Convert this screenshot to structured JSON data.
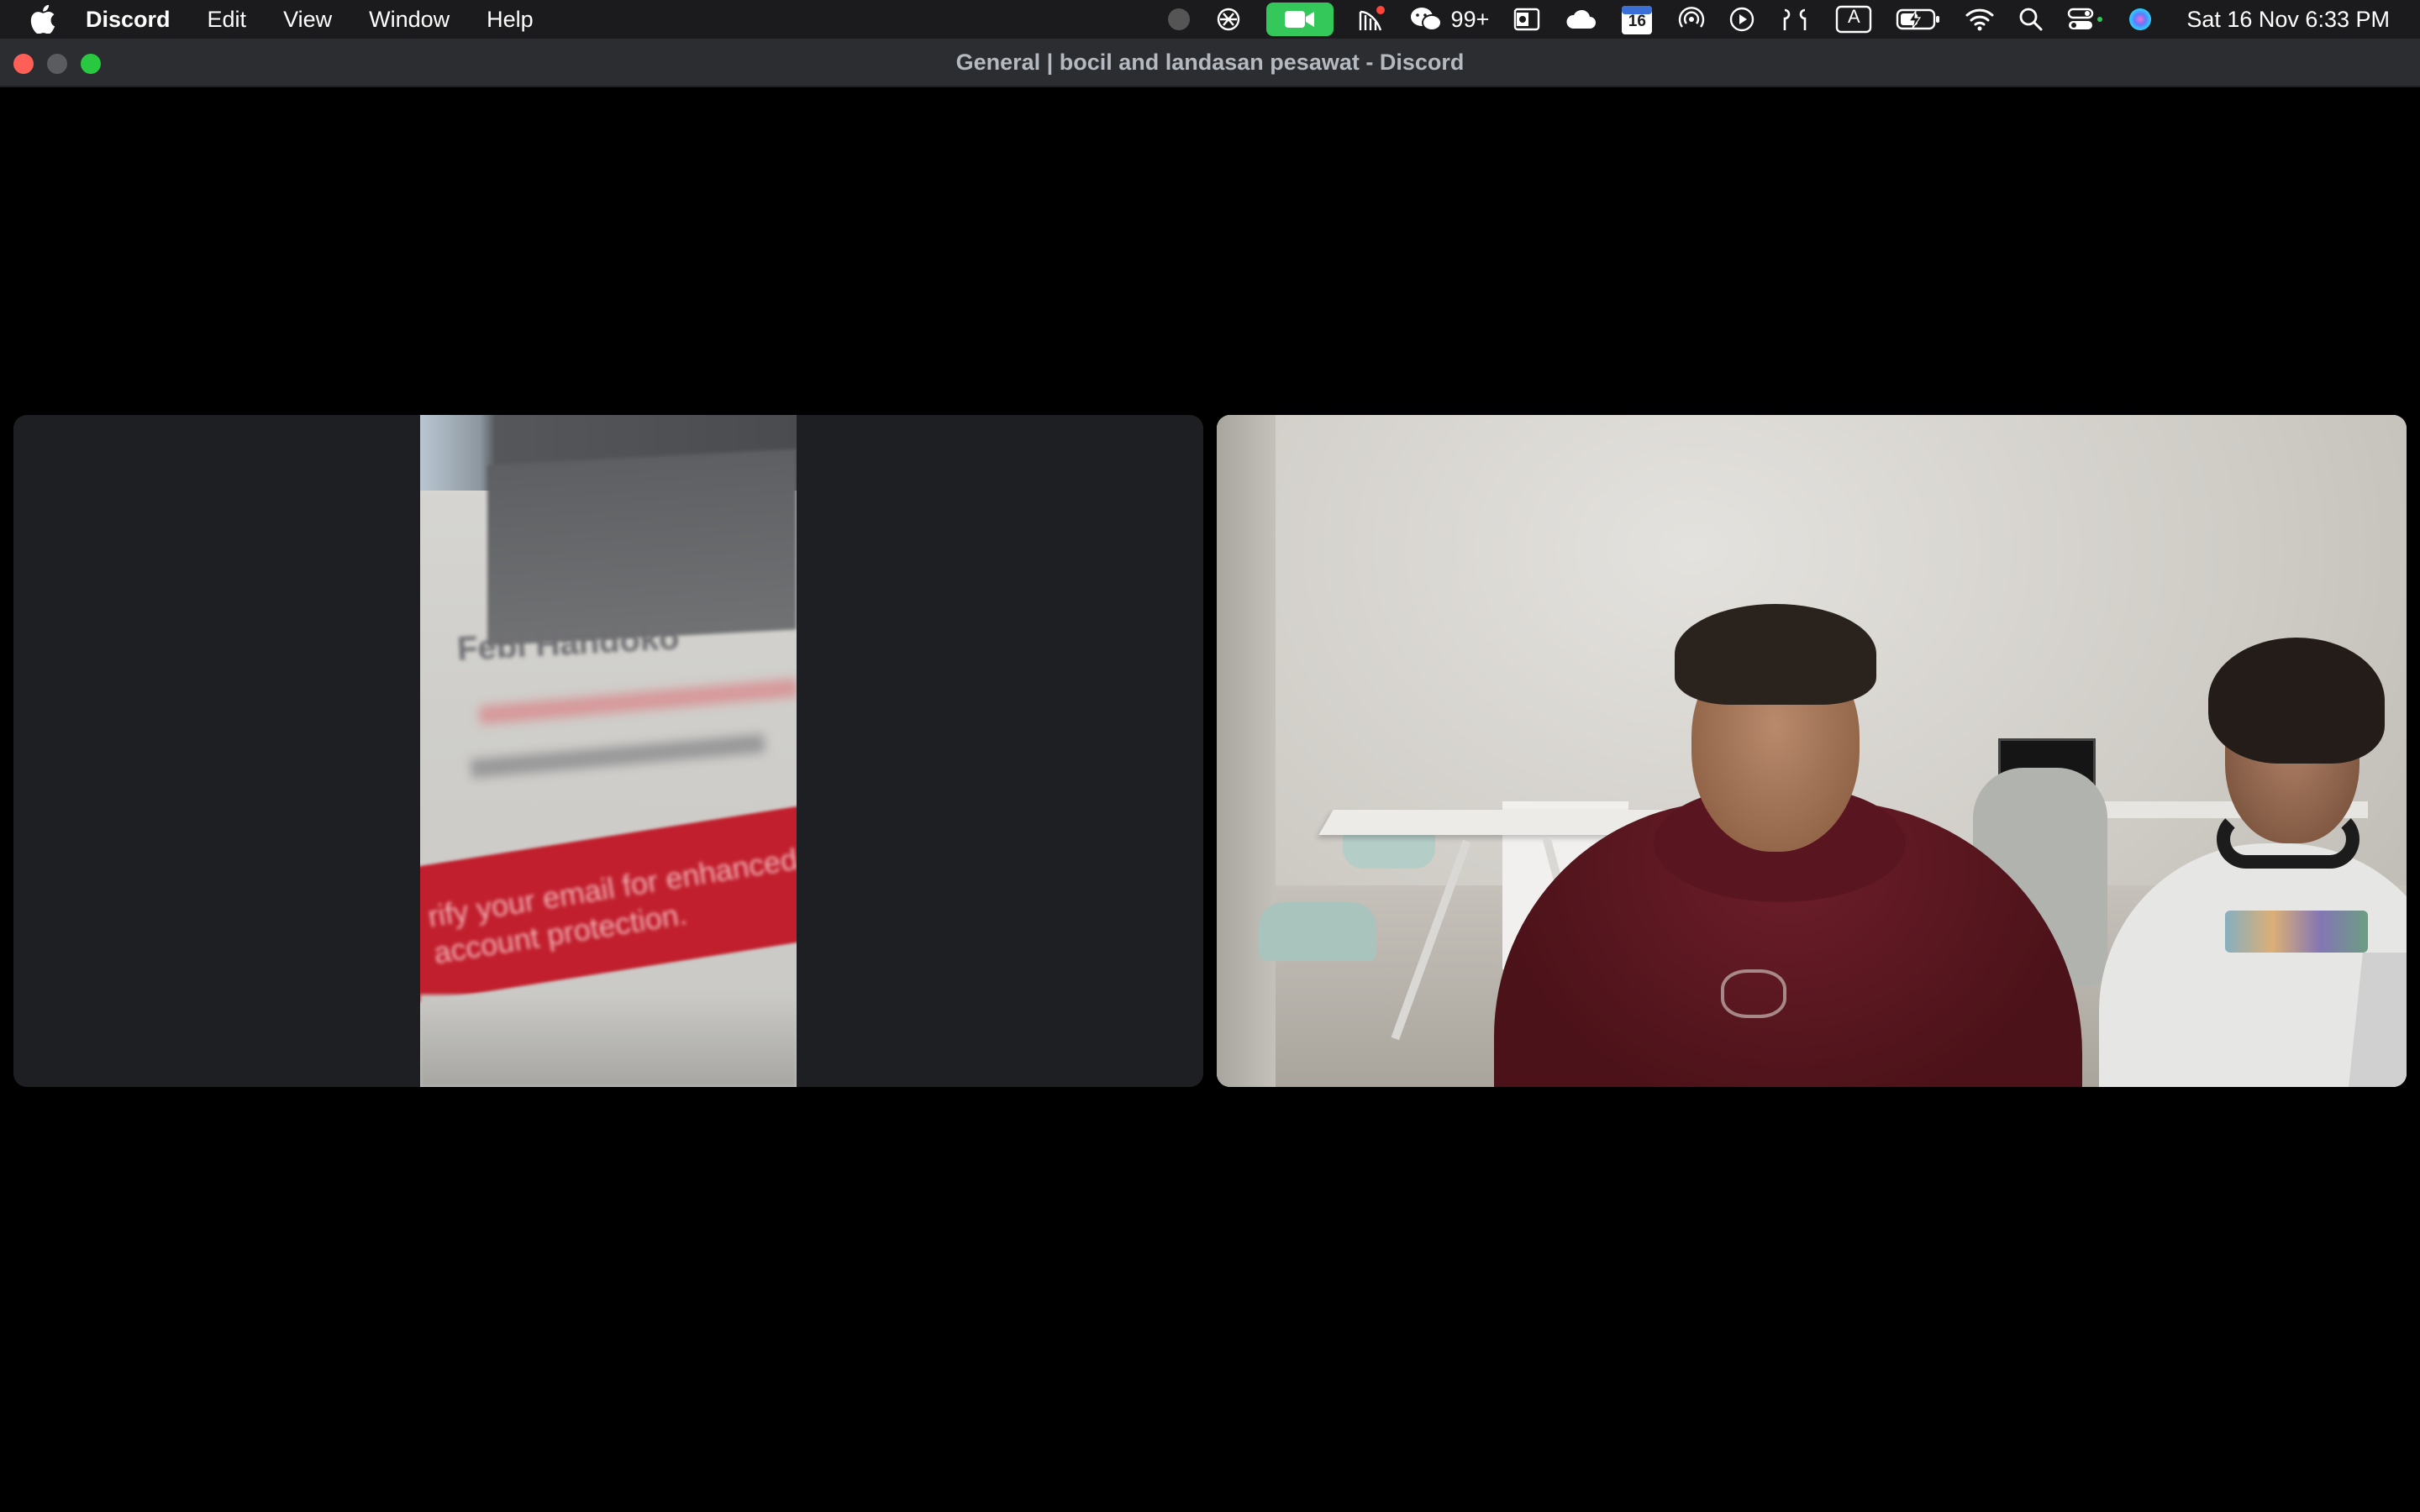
{
  "menubar": {
    "app_name": "Discord",
    "menus": [
      "Edit",
      "View",
      "Window",
      "Help"
    ],
    "notification_count": "99+",
    "calendar_day": "16",
    "keyboard_input": "A",
    "datetime": "Sat 16 Nov  6:33 PM",
    "status_icons": [
      "record-icon",
      "chatgpt-icon",
      "facetime-camera-icon",
      "network-activity-icon",
      "wechat-icon",
      "outlook-icon",
      "icloud-icon",
      "calendar-icon",
      "airdrop-icon",
      "play-icon",
      "airpods-icon",
      "input-source-icon",
      "battery-charging-icon",
      "wifi-icon",
      "spotlight-search-icon",
      "control-center-icon",
      "siri-icon"
    ],
    "accent_colors": {
      "facetime": "#34c759",
      "menubar_bg": "#1b1b1d"
    }
  },
  "window": {
    "title": "General | bocil and landasan pesawat - Discord",
    "traffic_light_colors": {
      "close": "#ff5f57",
      "minimize": "#5b5c60",
      "maximize": "#28c840"
    }
  },
  "video_tiles": [
    {
      "kind": "camera-feed",
      "visible_text": {
        "name": "Febi Handoko",
        "band_text": "rify your email for enhanced account protection."
      }
    },
    {
      "kind": "camera-feed"
    }
  ]
}
